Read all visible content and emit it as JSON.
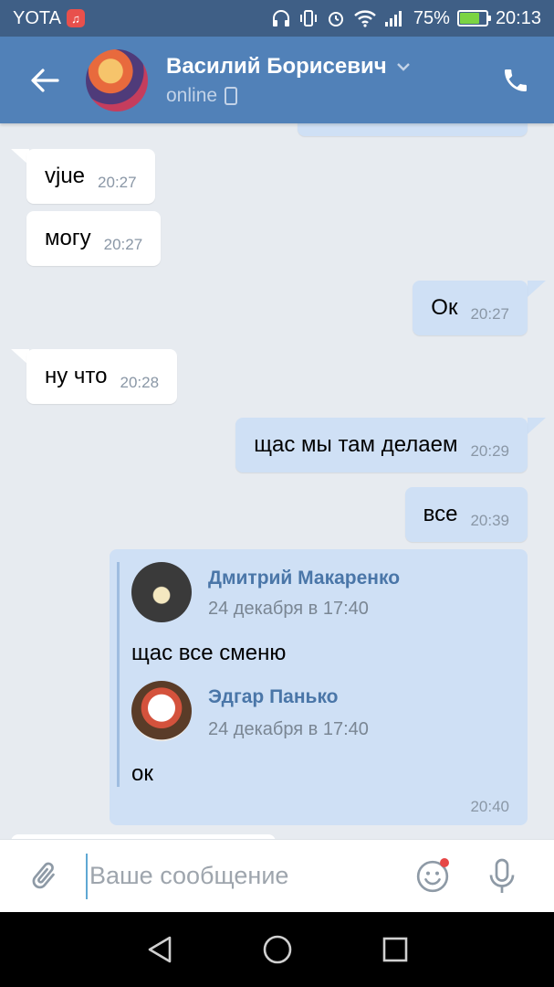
{
  "status_bar": {
    "carrier": "YOTA",
    "battery_percent": "75%",
    "battery_level": 0.75,
    "time": "20:13"
  },
  "header": {
    "contact_name": "Василий Борисевич",
    "status": "online"
  },
  "messages": [
    {
      "direction": "in",
      "text": "vjue",
      "time": "20:27"
    },
    {
      "direction": "in",
      "text": "могу",
      "time": "20:27"
    },
    {
      "direction": "out",
      "text": "Ок",
      "time": "20:27"
    },
    {
      "direction": "in",
      "text": "ну что",
      "time": "20:28"
    },
    {
      "direction": "out",
      "text": "щас мы там делаем",
      "time": "20:29"
    },
    {
      "direction": "out",
      "text": "все",
      "time": "20:39"
    }
  ],
  "forwarded": {
    "time": "20:40",
    "items": [
      {
        "author": "Дмитрий Макаренко",
        "date": "24 декабря в 17:40",
        "text": "щас все сменю"
      },
      {
        "author": "Эдгар Панько",
        "date": "24 декабря в 17:40",
        "text": "ок"
      }
    ]
  },
  "input": {
    "placeholder": "Ваше сообщение"
  },
  "colors": {
    "header": "#5181b8",
    "statusbar": "#3f5f86",
    "background": "#e7ebf0",
    "bubble_out": "#cfe0f5",
    "bubble_in": "#ffffff",
    "link": "#4a76a8"
  },
  "icons": [
    "back-arrow-icon",
    "chevron-down-icon",
    "mobile-phone-icon",
    "call-icon",
    "attach-icon",
    "emoji-icon",
    "microphone-icon",
    "nav-back-icon",
    "nav-home-icon",
    "nav-recents-icon"
  ]
}
